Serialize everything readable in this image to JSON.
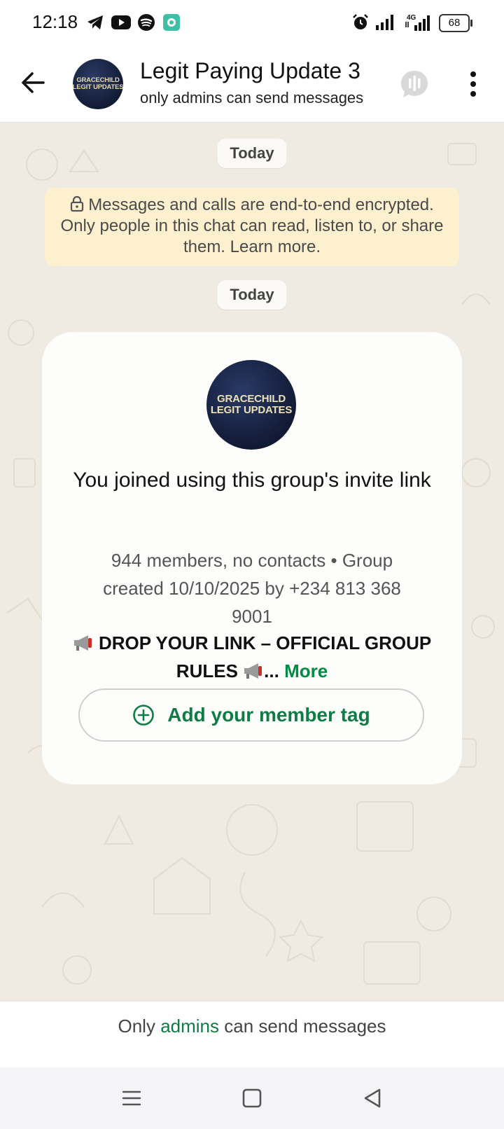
{
  "status_bar": {
    "time": "12:18",
    "battery": "68",
    "icons": [
      "telegram-icon",
      "youtube-icon",
      "spotify-icon",
      "app-notification-icon",
      "alarm-icon",
      "signal-icon",
      "4g-signal-icon",
      "battery-icon"
    ]
  },
  "header": {
    "title": "Legit Paying Update 3",
    "subtitle": "only admins can send messages",
    "avatar_text": [
      "GRACECHILD",
      "LEGIT UPDATES"
    ]
  },
  "chat": {
    "date_1": "Today",
    "encryption_notice": "Messages and calls are end-to-end encrypted. Only people in this chat can read, listen to, or share them. Learn more.",
    "date_2": "Today",
    "card": {
      "avatar_text": [
        "GRACECHILD",
        "LEGIT UPDATES"
      ],
      "joined_text": "You joined using this group's invite link",
      "info_text": "944 members, no contacts • Group created 10/10/2025 by +234 813 368 9001",
      "rules_text": "DROP YOUR LINK – OFFICIAL GROUP RULES",
      "rules_ellipsis": "...",
      "more_label": "More",
      "tag_button_label": "Add your member tag"
    }
  },
  "footer": {
    "prefix": "Only",
    "admins_link": "admins",
    "suffix": "can send messages"
  },
  "colors": {
    "accent_green": "#0f7b45",
    "chat_background": "#efeae2",
    "encryption_background": "#fdf0cf"
  }
}
